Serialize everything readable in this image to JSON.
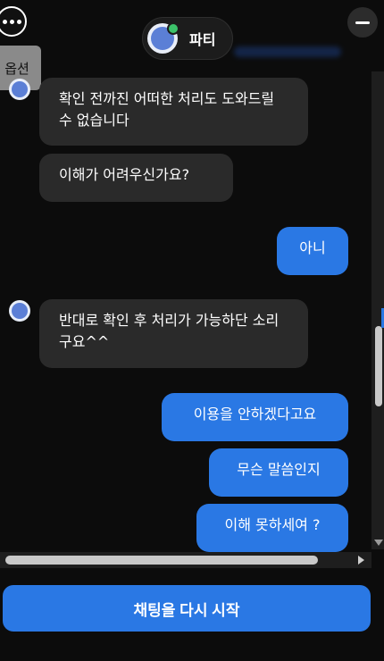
{
  "header": {
    "options_tooltip": "옵션",
    "bot_name": "파티"
  },
  "messages": [
    {
      "from": "bot",
      "text": "확인 전까진 어떠한 처리도 도와드릴 수 없습니다"
    },
    {
      "from": "bot",
      "text": "이해가 어려우신가요?"
    },
    {
      "from": "user",
      "text": "아니"
    },
    {
      "from": "bot",
      "text": "반대로 확인 후 처리가 가능하단 소리구요^^"
    },
    {
      "from": "user",
      "text": "이용을 안하겠다고요"
    },
    {
      "from": "user",
      "text": "무슨 말씀인지"
    },
    {
      "from": "user",
      "text": "이해 못하세여 ?"
    }
  ],
  "footer": {
    "restart_label": "채팅을 다시 시작"
  },
  "icons": {
    "more": "more-dots-icon",
    "minimize": "minimize-icon"
  },
  "colors": {
    "accent": "#2a78e4",
    "bot_bubble": "#2a2a2a",
    "background": "#0c0c0c"
  }
}
